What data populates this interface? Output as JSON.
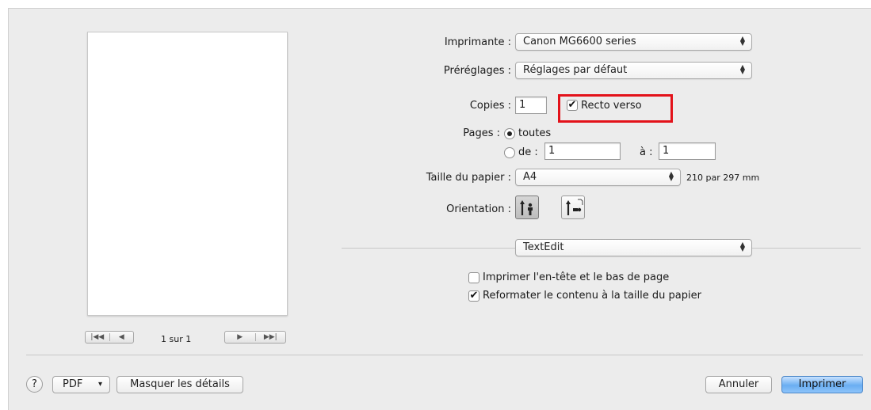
{
  "printer": {
    "label": "Imprimante :",
    "value": "Canon MG6600 series"
  },
  "presets": {
    "label": "Préréglages :",
    "value": "Réglages par défaut"
  },
  "copies": {
    "label": "Copies :",
    "value": "1",
    "duplex_label": "Recto verso",
    "duplex_checked": true
  },
  "pages": {
    "label": "Pages :",
    "all_label": "toutes",
    "from_label": "de :",
    "from_value": "1",
    "to_label": "à :",
    "to_value": "1",
    "selected": "all"
  },
  "paper_size": {
    "label": "Taille du papier :",
    "value": "A4",
    "dimensions": "210 par 297 mm"
  },
  "orientation": {
    "label": "Orientation :",
    "selected": "portrait"
  },
  "section_popup": {
    "value": "TextEdit"
  },
  "options": [
    {
      "label": "Imprimer l'en-tête et le bas de page",
      "checked": false
    },
    {
      "label": "Reformater le contenu à la taille du papier",
      "checked": true
    }
  ],
  "preview": {
    "page_indicator": "1 sur 1"
  },
  "footer": {
    "help": "?",
    "pdf_label": "PDF",
    "pdf_arrow": "▾",
    "hide_details": "Masquer les détails",
    "cancel": "Annuler",
    "print": "Imprimer"
  },
  "colors": {
    "highlight": "#e3121a",
    "default_button": "#6aaef2"
  }
}
